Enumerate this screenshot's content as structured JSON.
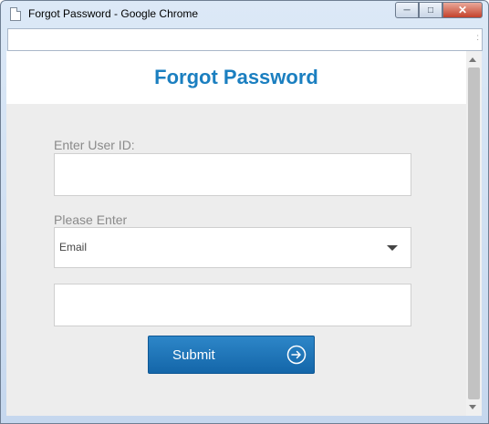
{
  "window": {
    "title": "Forgot Password - Google Chrome",
    "controls": {
      "minimize": "─",
      "maximize": "□",
      "close": "✕"
    }
  },
  "addressbar": {
    "value": "",
    "edge_mark": ":"
  },
  "form": {
    "heading": "Forgot Password",
    "user_id_label": "Enter User ID:",
    "user_id_value": "",
    "method_label": "Please Enter",
    "method_selected": "Email",
    "method_value": "",
    "submit_label": "Submit"
  },
  "colors": {
    "heading": "#1b7fc0",
    "submit_button": "#1a73b9",
    "content_background": "#ededed"
  },
  "icons": {
    "page": "page-icon",
    "submit_arrow": "arrow-circle-right-icon",
    "dropdown": "chevron-down-icon"
  }
}
